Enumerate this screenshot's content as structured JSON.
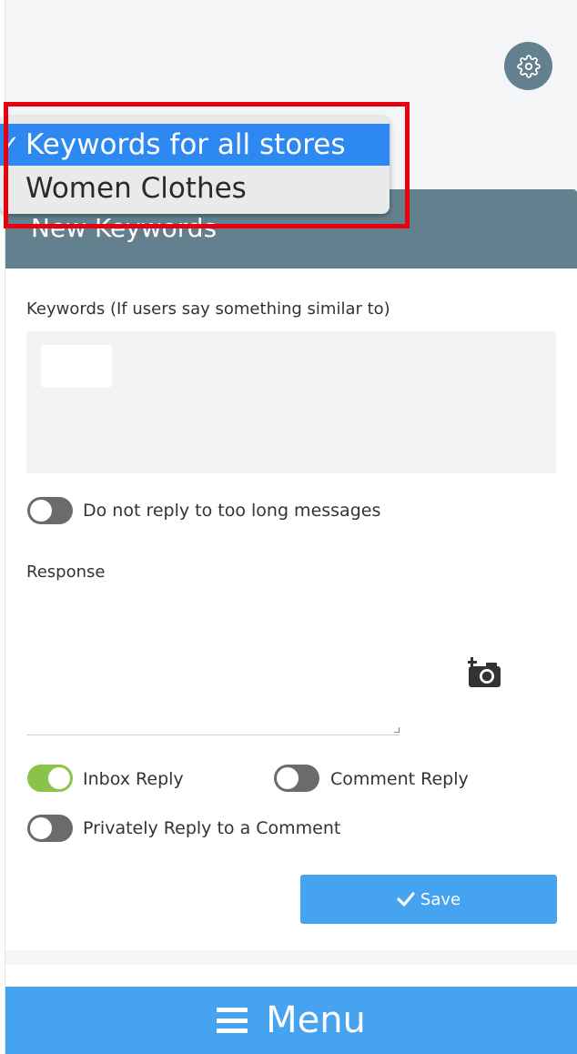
{
  "dropdown": {
    "options": [
      {
        "label": "Keywords for all stores",
        "selected": true
      },
      {
        "label": "Women Clothes",
        "selected": false
      }
    ]
  },
  "card": {
    "title": "New Keywords",
    "keywords_label": "Keywords (If users say something similar to)",
    "long_message_toggle": {
      "label": "Do not reply to too long messages",
      "on": false
    },
    "response_label": "Response",
    "response_value": "",
    "reply_toggles": {
      "inbox": {
        "label": "Inbox Reply",
        "on": true
      },
      "comment": {
        "label": "Comment Reply",
        "on": false
      },
      "private": {
        "label": "Privately Reply to a Comment",
        "on": false
      }
    },
    "save_label": "Save"
  },
  "menu": {
    "label": "Menu"
  },
  "icons": {
    "settings": "gear-icon",
    "camera": "camera-plus-icon",
    "check": "check-icon",
    "menu": "hamburger-icon"
  },
  "colors": {
    "header": "#62808e",
    "accent_blue": "#45a3ef",
    "toggle_on": "#8bc34a",
    "toggle_off": "#6b6b6b",
    "selection_blue": "#2e88f1",
    "highlight_red": "#e8000e"
  }
}
